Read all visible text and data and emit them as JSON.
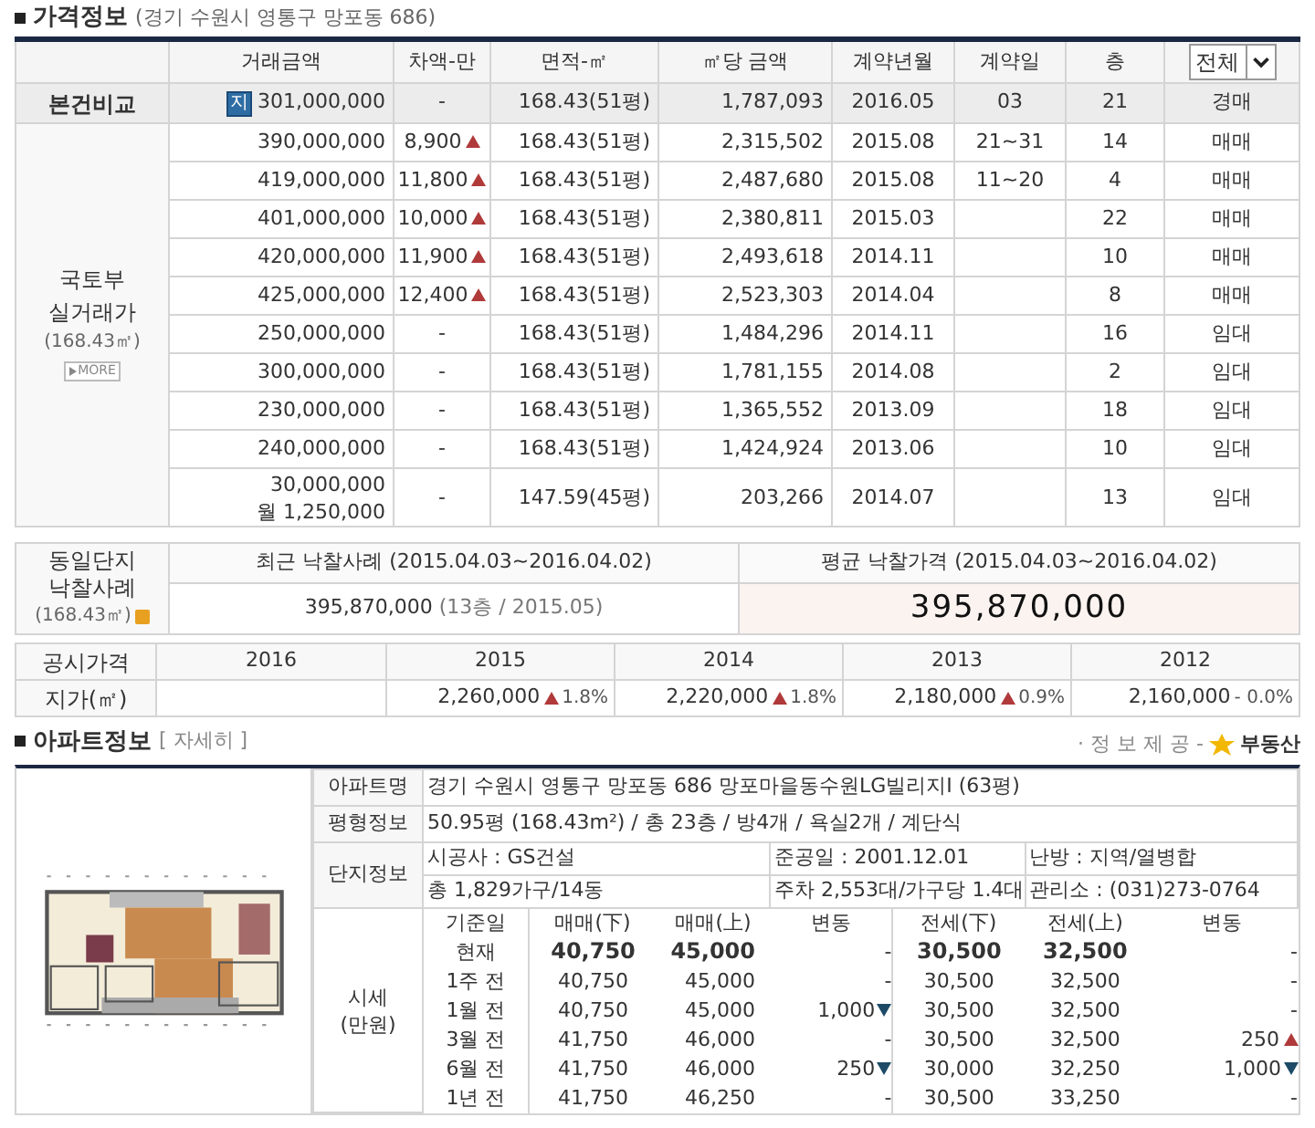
{
  "price_info": {
    "title": "가격정보",
    "address": "(경기 수원시 영통구 망포동 686)",
    "columns": [
      "거래금액",
      "차액-만",
      "면적-㎡",
      "㎡당 금액",
      "계약년월",
      "계약일",
      "층"
    ],
    "filter": {
      "value": "전체"
    },
    "subject": {
      "label": "본건비교",
      "badge": "지",
      "price": [
        "301,000,000"
      ],
      "diff": "-",
      "increase": false,
      "area": "168.43(51평)",
      "per_m2": "1,787,093",
      "ym": "2016.05",
      "day": "03",
      "floor": "21",
      "type": "경매"
    },
    "group_label": [
      "국토부",
      "실거래가",
      "(168.43㎡)"
    ],
    "more_button": "MORE",
    "rows": [
      {
        "price": [
          "390,000,000"
        ],
        "diff": "8,900",
        "increase": true,
        "area": "168.43(51평)",
        "per_m2": "2,315,502",
        "ym": "2015.08",
        "day": "21~31",
        "floor": "14",
        "type": "매매"
      },
      {
        "price": [
          "419,000,000"
        ],
        "diff": "11,800",
        "increase": true,
        "area": "168.43(51평)",
        "per_m2": "2,487,680",
        "ym": "2015.08",
        "day": "11~20",
        "floor": "4",
        "type": "매매"
      },
      {
        "price": [
          "401,000,000"
        ],
        "diff": "10,000",
        "increase": true,
        "area": "168.43(51평)",
        "per_m2": "2,380,811",
        "ym": "2015.03",
        "floor": "22",
        "type": "매매"
      },
      {
        "price": [
          "420,000,000"
        ],
        "diff": "11,900",
        "increase": true,
        "area": "168.43(51평)",
        "per_m2": "2,493,618",
        "ym": "2014.11",
        "floor": "10",
        "type": "매매"
      },
      {
        "price": [
          "425,000,000"
        ],
        "diff": "12,400",
        "increase": true,
        "area": "168.43(51평)",
        "per_m2": "2,523,303",
        "ym": "2014.04",
        "floor": "8",
        "type": "매매"
      },
      {
        "price": [
          "250,000,000"
        ],
        "diff": "-",
        "increase": false,
        "area": "168.43(51평)",
        "per_m2": "1,484,296",
        "ym": "2014.11",
        "floor": "16",
        "type": "임대"
      },
      {
        "price": [
          "300,000,000"
        ],
        "diff": "-",
        "increase": false,
        "area": "168.43(51평)",
        "per_m2": "1,781,155",
        "ym": "2014.08",
        "floor": "2",
        "type": "임대"
      },
      {
        "price": [
          "230,000,000"
        ],
        "diff": "-",
        "increase": false,
        "area": "168.43(51평)",
        "per_m2": "1,365,552",
        "ym": "2013.09",
        "floor": "18",
        "type": "임대"
      },
      {
        "price": [
          "240,000,000"
        ],
        "diff": "-",
        "increase": false,
        "area": "168.43(51평)",
        "per_m2": "1,424,924",
        "ym": "2013.06",
        "floor": "10",
        "type": "임대"
      },
      {
        "price": [
          "30,000,000",
          "월 1,250,000"
        ],
        "diff": "-",
        "increase": false,
        "area": "147.59(45평)",
        "per_m2": "203,266",
        "ym": "2014.07",
        "floor": "13",
        "type": "임대"
      }
    ]
  },
  "auction": {
    "label": [
      "동일단지",
      "낙찰사례",
      "(168.43㎡)"
    ],
    "recent_title": "최근 낙찰사례 (2015.04.03~2016.04.02)",
    "recent_price": "395,870,000",
    "recent_detail": "(13층 / 2015.05)",
    "average_title": "평균 낙찰가격 (2015.04.03~2016.04.02)",
    "average_price": "395,870,000"
  },
  "official": {
    "label": "공시가격",
    "row_label": "지가(㎡)",
    "years": [
      {
        "year": "2016"
      },
      {
        "year": "2015",
        "price": "2,260,000",
        "increase": true,
        "pct": "1.8%"
      },
      {
        "year": "2014",
        "price": "2,220,000",
        "increase": true,
        "pct": "1.8%"
      },
      {
        "year": "2013",
        "price": "2,180,000",
        "increase": true,
        "pct": "0.9%"
      },
      {
        "year": "2012",
        "price": "2,160,000",
        "increase": false,
        "pct": "- 0.0%"
      }
    ]
  },
  "apartment": {
    "title": "아파트정보",
    "detail_link": "[ 자세히 ]",
    "credit": "· 정 보 제 공 -",
    "provider": "부동산",
    "name_label": "아파트명",
    "name": "경기 수원시 영통구 망포동 686 망포마을동수원LG빌리지I (63평)",
    "size_label": "평형정보",
    "size": "50.95평 (168.43m²) / 총 23층 / 방4개 / 욕실2개 / 계단식",
    "complex_label": "단지정보",
    "complex": [
      [
        "시공사 : GS건설",
        "준공일 : 2001.12.01",
        "난방 : 지역/열병합"
      ],
      [
        "총 1,829가구/14동",
        "주차 2,553대/가구당 1.4대",
        "관리소 : (031)273-0764"
      ]
    ],
    "market_label": [
      "시세",
      "(만원)"
    ],
    "market_columns": [
      "기준일",
      "매매(下)",
      "매매(上)",
      "변동",
      "전세(下)",
      "전세(上)",
      "변동"
    ],
    "market_rows": [
      {
        "date": "현재",
        "current": true,
        "sale_low": "40,750",
        "sale_high": "45,000",
        "sale_change": "-",
        "sale_fall": false,
        "rent_low": "30,500",
        "rent_high": "32,500",
        "rent_change": "-",
        "rent_rise": false,
        "rent_fall": false
      },
      {
        "date": "1주 전",
        "current": false,
        "sale_low": "40,750",
        "sale_high": "45,000",
        "sale_change": "-",
        "sale_fall": false,
        "rent_low": "30,500",
        "rent_high": "32,500",
        "rent_change": "-",
        "rent_rise": false,
        "rent_fall": false
      },
      {
        "date": "1월 전",
        "current": false,
        "sale_low": "40,750",
        "sale_high": "45,000",
        "sale_change": "1,000",
        "sale_fall": true,
        "rent_low": "30,500",
        "rent_high": "32,500",
        "rent_change": "-",
        "rent_rise": false,
        "rent_fall": false
      },
      {
        "date": "3월 전",
        "current": false,
        "sale_low": "41,750",
        "sale_high": "46,000",
        "sale_change": "-",
        "sale_fall": false,
        "rent_low": "30,500",
        "rent_high": "32,500",
        "rent_change": "250",
        "rent_rise": true,
        "rent_fall": false
      },
      {
        "date": "6월 전",
        "current": false,
        "sale_low": "41,750",
        "sale_high": "46,000",
        "sale_change": "250",
        "sale_fall": true,
        "rent_low": "30,000",
        "rent_high": "32,250",
        "rent_change": "1,000",
        "rent_rise": false,
        "rent_fall": true
      },
      {
        "date": "1년 전",
        "current": false,
        "sale_low": "41,750",
        "sale_high": "46,250",
        "sale_change": "-",
        "sale_fall": false,
        "rent_low": "30,500",
        "rent_high": "33,250",
        "rent_change": "-",
        "rent_rise": false,
        "rent_fall": false
      }
    ]
  }
}
